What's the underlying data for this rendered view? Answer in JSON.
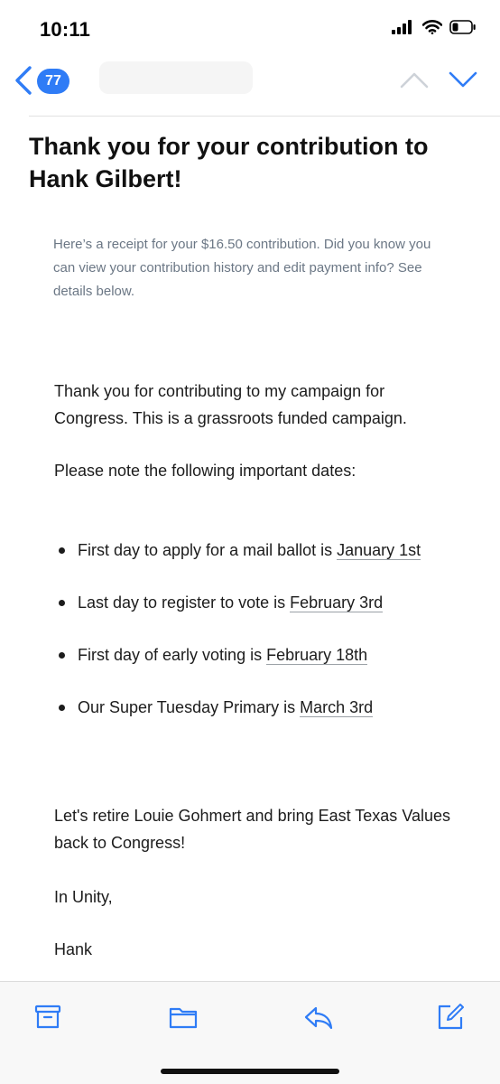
{
  "status_bar": {
    "time": "10:11",
    "icons": [
      "signal-icon",
      "wifi-icon",
      "battery-icon"
    ]
  },
  "nav": {
    "back_icon": "chevron-left-icon",
    "message_count": "77",
    "up_icon": "chevron-up-icon",
    "down_icon": "chevron-down-icon",
    "accent_color": "#2f7cf6"
  },
  "email": {
    "title": "Thank you for your contribution to Hank Gilbert!",
    "receipt_note": "Here’s a receipt for your $16.50 contribution. Did you know you can view your contribution history and edit payment info? See details below.",
    "paragraph_1": "Thank you for contributing to my campaign for Congress. This is a grassroots funded campaign.",
    "paragraph_2": "Please note the following important dates:",
    "bullets": [
      {
        "text": "First day to apply for a mail ballot is ",
        "date": "January 1st"
      },
      {
        "text": "Last day to register to vote is ",
        "date": "February 3rd"
      },
      {
        "text": "First day of early voting is ",
        "date": "February 18th"
      },
      {
        "text": "Our Super Tuesday Primary is ",
        "date": "March 3rd"
      }
    ],
    "paragraph_3": "Let's retire Louie Gohmert and bring East Texas Values back to Congress!",
    "closing": "In Unity,",
    "signature": "Hank"
  },
  "toolbar": {
    "icons": [
      "archive-icon",
      "folder-icon",
      "reply-icon",
      "compose-icon"
    ]
  }
}
